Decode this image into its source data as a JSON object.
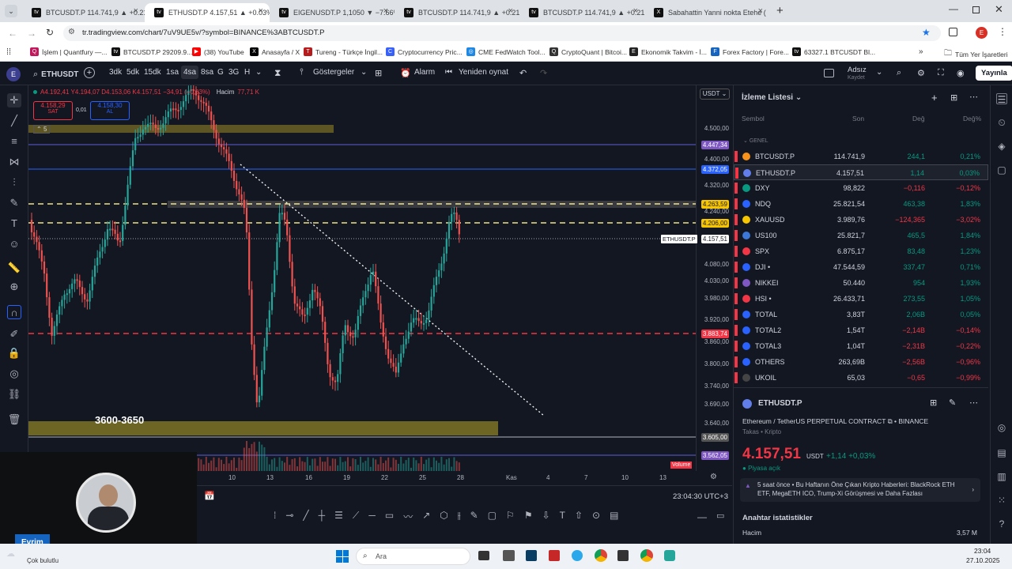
{
  "browser": {
    "tabs": [
      {
        "title": "BTCUSDT.P 114.741,9 ▲ +0.21%",
        "icon": "tv-icon"
      },
      {
        "title": "ETHUSDT.P 4.157,51 ▲ +0.03%",
        "icon": "tv-icon",
        "active": true
      },
      {
        "title": "EIGENUSDT.P 1,1050 ▼ −7.66%",
        "icon": "tv-icon"
      },
      {
        "title": "BTCUSDT.P 114.741,9 ▲ +0.21%",
        "icon": "tv-icon"
      },
      {
        "title": "BTCUSDT.P 114.741,9 ▲ +0.21%",
        "icon": "tv-icon"
      },
      {
        "title": "Sabahattin Yanni nokta Etehe (",
        "icon": "x-icon"
      }
    ],
    "url": "tr.tradingview.com/chart/7uV9UE5v/?symbol=BINANCE%3ABTCUSDT.P",
    "bookmarks": [
      "İşlem | Quantfury —...",
      "BTCUSDT.P 29209.9...",
      "(38) YouTube",
      "Anasayfa / X",
      "Tureng - Türkçe İngil...",
      "Cryptocurrency Pric...",
      "CME FedWatch Tool...",
      "CryptoQuant | Bitcoi...",
      "Ekonomik Takvim - İ...",
      "Forex Factory | Fore...",
      "63327.1 BTCUSDT Bl..."
    ],
    "all_bookmarks": "Tüm Yer İşaretleri"
  },
  "toolbar": {
    "symbol": "ETHUSDT",
    "intervals": [
      "3dk",
      "5dk",
      "15dk",
      "1sa",
      "4sa",
      "8sa",
      "G",
      "3G",
      "H"
    ],
    "active_interval": "4sa",
    "indicators": "Göstergeler",
    "alert": "Alarm",
    "replay": "Yeniden oynat",
    "unsaved": "Adsız",
    "saved": "Kaydet",
    "publish": "Yayınla"
  },
  "legend": {
    "ohlc": "A4.192,41 Y4.194,07 D4.153,06 K4.157,51 −34,91 (−0,83%)",
    "volume_label": "Hacim",
    "volume": "77,71 K",
    "sell_price": "4.158,29",
    "sell": "SAT",
    "spread": "0,01",
    "buy_price": "4.158,30",
    "buy": "AL",
    "layers": "5"
  },
  "chart": {
    "currency": "USDT",
    "price_labels": [
      "4.500,00",
      "4.400,00",
      "4.320,00",
      "4.240,00",
      "4.080,00",
      "4.030,00",
      "3.980,00",
      "3.920,00",
      "3.860,00",
      "3.800,00",
      "3.740,00",
      "3.690,00",
      "3.640,00"
    ],
    "tags": [
      {
        "text": "4.447,34",
        "color": "#7e57c2"
      },
      {
        "text": "4.372,05",
        "color": "#2962ff"
      },
      {
        "text": "4.263,59",
        "color": "#f7c600"
      },
      {
        "text": "4.206,00",
        "color": "#f7c600"
      },
      {
        "text": "4.157,51",
        "color": "#ffffff"
      },
      {
        "text": "3.883,74",
        "color": "#f23645"
      },
      {
        "text": "3.605,00",
        "color": "#555555"
      },
      {
        "text": "3.562,05",
        "color": "#7e57c2"
      }
    ],
    "last_symbol": "ETHUSDT.P",
    "zone_label": "3600-3650",
    "volume_tag": "Volume",
    "time_labels": [
      "10",
      "13",
      "16",
      "19",
      "22",
      "25",
      "28",
      "Kas",
      "4",
      "7",
      "10",
      "13"
    ],
    "clock": "23:04:30 UTC+3"
  },
  "watchlist": {
    "title": "İzleme Listesi",
    "cols": [
      "Sembol",
      "Son",
      "Değ",
      "Değ%"
    ],
    "group": "GENEL",
    "rows": [
      {
        "sym": "BTCUSDT.P",
        "last": "114.741,9",
        "chg": "244,1",
        "pct": "0,21%",
        "up": true,
        "color": "#f7931a"
      },
      {
        "sym": "ETHUSDT.P",
        "last": "4.157,51",
        "chg": "1,14",
        "pct": "0,03%",
        "up": true,
        "color": "#627eea"
      },
      {
        "sym": "DXY",
        "last": "98,822",
        "chg": "−0,116",
        "pct": "−0,12%",
        "up": false,
        "color": "#089981"
      },
      {
        "sym": "NDQ",
        "last": "25.821,54",
        "chg": "463,38",
        "pct": "1,83%",
        "up": true,
        "color": "#2962ff"
      },
      {
        "sym": "XAUUSD",
        "last": "3.989,76",
        "chg": "−124,365",
        "pct": "−3,02%",
        "up": false,
        "color": "#f7c600"
      },
      {
        "sym": "US100",
        "last": "25.821,7",
        "chg": "465,5",
        "pct": "1,84%",
        "up": true,
        "color": "#3c78d8"
      },
      {
        "sym": "SPX",
        "last": "6.875,17",
        "chg": "83,48",
        "pct": "1,23%",
        "up": true,
        "color": "#f23645"
      },
      {
        "sym": "DJI •",
        "last": "47.544,59",
        "chg": "337,47",
        "pct": "0,71%",
        "up": true,
        "color": "#2962ff"
      },
      {
        "sym": "NIKKEI",
        "last": "50.440",
        "chg": "954",
        "pct": "1,93%",
        "up": true,
        "color": "#7e57c2"
      },
      {
        "sym": "HSI •",
        "last": "26.433,71",
        "chg": "273,55",
        "pct": "1,05%",
        "up": true,
        "color": "#f23645"
      },
      {
        "sym": "TOTAL",
        "last": "3,83T",
        "chg": "2,06B",
        "pct": "0,05%",
        "up": true,
        "color": "#2962ff"
      },
      {
        "sym": "TOTAL2",
        "last": "1,54T",
        "chg": "−2,14B",
        "pct": "−0,14%",
        "up": false,
        "color": "#2962ff"
      },
      {
        "sym": "TOTAL3",
        "last": "1,04T",
        "chg": "−2,31B",
        "pct": "−0,22%",
        "up": false,
        "color": "#2962ff"
      },
      {
        "sym": "OTHERS",
        "last": "263,69B",
        "chg": "−2,56B",
        "pct": "−0,96%",
        "up": false,
        "color": "#2962ff"
      },
      {
        "sym": "UKOIL",
        "last": "65,03",
        "chg": "−0,65",
        "pct": "−0,99%",
        "up": false,
        "color": "#444"
      }
    ]
  },
  "detail": {
    "symbol": "ETHUSDT.P",
    "name": "Ethereum / TetherUS PERPETUAL CONTRACT",
    "exchange": "BINANCE",
    "sub": "Takas • Kripto",
    "price": "4.157,51",
    "currency": "USDT",
    "change": "+1,14  +0,03%",
    "market": "Piyasa açık",
    "news": "5 saat önce • Bu Haftanın Öne Çıkan Kripto Haberleri: BlackRock ETH ETF, MegaETH ICO, Trump-Xi Görüşmesi ve Daha Fazlası",
    "stats_title": "Anahtar istatistikler",
    "volume_label": "Hacim",
    "volume": "3,57 M"
  },
  "webcam": {
    "name": "Evrim"
  },
  "taskbar": {
    "weather": "Çok bulutlu",
    "search": "Ara",
    "time": "23:04",
    "date": "27.10.2025"
  }
}
